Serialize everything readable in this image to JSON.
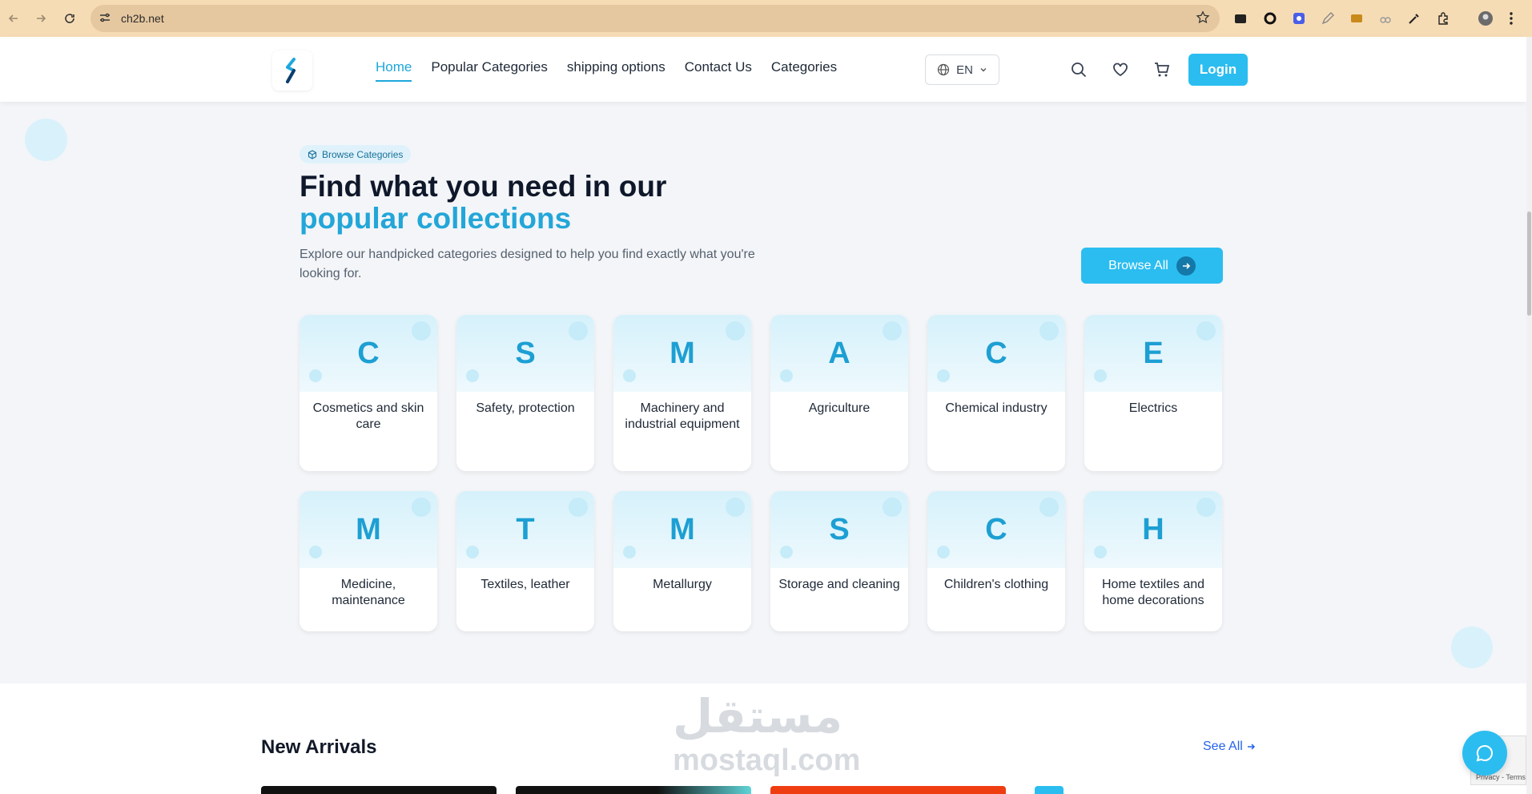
{
  "browser": {
    "url": "ch2b.net"
  },
  "header": {
    "nav": [
      {
        "label": "Home",
        "active": true
      },
      {
        "label": "Popular Categories"
      },
      {
        "label": "shipping options"
      },
      {
        "label": "Contact Us"
      },
      {
        "label": "Categories"
      }
    ],
    "language": "EN",
    "login_label": "Login"
  },
  "section": {
    "badge": "Browse Categories",
    "title_line1": "Find what you need in our",
    "title_line2": "popular collections",
    "description": "Explore our handpicked categories designed to help you find exactly what you're looking for.",
    "browse_all": "Browse All"
  },
  "categories": [
    {
      "letter": "C",
      "name": "Cosmetics and skin care"
    },
    {
      "letter": "S",
      "name": "Safety, protection"
    },
    {
      "letter": "M",
      "name": "Machinery and industrial equipment"
    },
    {
      "letter": "A",
      "name": "Agriculture"
    },
    {
      "letter": "C",
      "name": "Chemical industry"
    },
    {
      "letter": "E",
      "name": "Electrics"
    },
    {
      "letter": "M",
      "name": "Medicine, maintenance"
    },
    {
      "letter": "T",
      "name": "Textiles, leather"
    },
    {
      "letter": "M",
      "name": "Metallurgy"
    },
    {
      "letter": "S",
      "name": "Storage and cleaning"
    },
    {
      "letter": "C",
      "name": "Children's clothing"
    },
    {
      "letter": "H",
      "name": "Home textiles and home decorations"
    }
  ],
  "new_arrivals": {
    "title": "New Arrivals",
    "see_all": "See All"
  },
  "watermark": {
    "arabic": "مستقل",
    "latin": "mostaql.com"
  },
  "recaptcha": "Privacy - Terms",
  "colors": {
    "accent": "#2bbdf0",
    "accent_dark": "#1d9fd3",
    "chrome": "#f6dcb5"
  }
}
